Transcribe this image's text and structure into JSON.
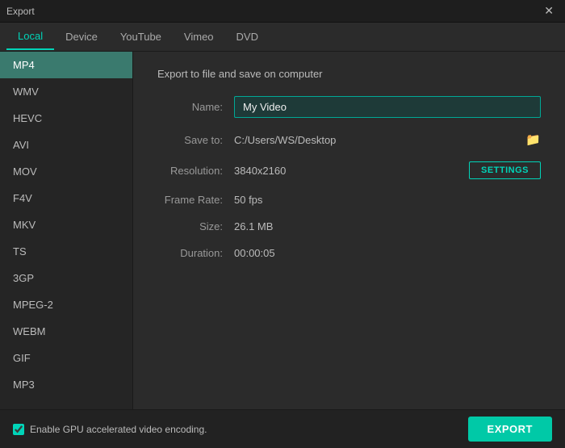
{
  "titleBar": {
    "title": "Export",
    "closeLabel": "✕"
  },
  "tabs": [
    {
      "id": "local",
      "label": "Local",
      "active": true
    },
    {
      "id": "device",
      "label": "Device",
      "active": false
    },
    {
      "id": "youtube",
      "label": "YouTube",
      "active": false
    },
    {
      "id": "vimeo",
      "label": "Vimeo",
      "active": false
    },
    {
      "id": "dvd",
      "label": "DVD",
      "active": false
    }
  ],
  "sidebar": {
    "items": [
      {
        "id": "mp4",
        "label": "MP4",
        "active": true
      },
      {
        "id": "wmv",
        "label": "WMV",
        "active": false
      },
      {
        "id": "hevc",
        "label": "HEVC",
        "active": false
      },
      {
        "id": "avi",
        "label": "AVI",
        "active": false
      },
      {
        "id": "mov",
        "label": "MOV",
        "active": false
      },
      {
        "id": "f4v",
        "label": "F4V",
        "active": false
      },
      {
        "id": "mkv",
        "label": "MKV",
        "active": false
      },
      {
        "id": "ts",
        "label": "TS",
        "active": false
      },
      {
        "id": "3gp",
        "label": "3GP",
        "active": false
      },
      {
        "id": "mpeg2",
        "label": "MPEG-2",
        "active": false
      },
      {
        "id": "webm",
        "label": "WEBM",
        "active": false
      },
      {
        "id": "gif",
        "label": "GIF",
        "active": false
      },
      {
        "id": "mp3",
        "label": "MP3",
        "active": false
      }
    ]
  },
  "content": {
    "title": "Export to file and save on computer",
    "fields": {
      "name": {
        "label": "Name:",
        "value": "My Video",
        "placeholder": "My Video"
      },
      "saveTo": {
        "label": "Save to:",
        "path": "C:/Users/WS/Desktop",
        "folderIcon": "📁"
      },
      "resolution": {
        "label": "Resolution:",
        "value": "3840x2160",
        "settingsLabel": "SETTINGS"
      },
      "frameRate": {
        "label": "Frame Rate:",
        "value": "50 fps"
      },
      "size": {
        "label": "Size:",
        "value": "26.1 MB"
      },
      "duration": {
        "label": "Duration:",
        "value": "00:00:05"
      }
    }
  },
  "bottomBar": {
    "gpuLabel": "Enable GPU accelerated video encoding.",
    "gpuChecked": true,
    "exportLabel": "EXPORT"
  }
}
